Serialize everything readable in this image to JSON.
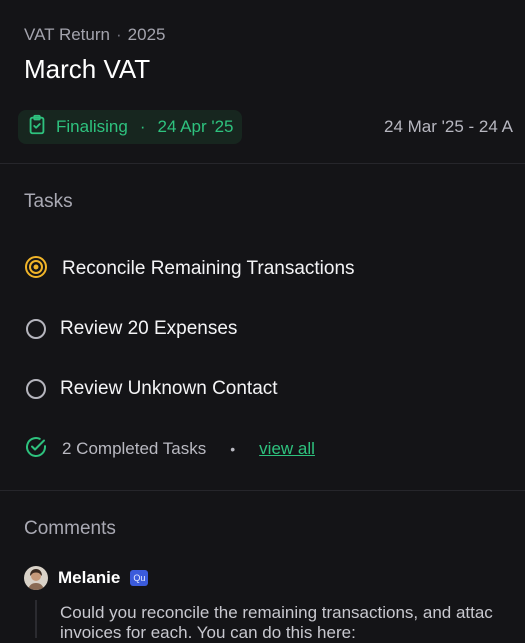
{
  "header": {
    "subtitle_prefix": "VAT Return",
    "subtitle_year": "2025",
    "title": "March VAT"
  },
  "status": {
    "label": "Finalising",
    "date": "24 Apr '25",
    "color": "#2ec27e"
  },
  "period": {
    "range": "24 Mar '25 - 24 A"
  },
  "tasks": {
    "heading": "Tasks",
    "items": [
      {
        "label": "Reconcile Remaining Transactions",
        "state": "in-progress",
        "icon": "target-icon"
      },
      {
        "label": "Review 20 Expenses",
        "state": "todo",
        "icon": "circle-icon"
      },
      {
        "label": "Review Unknown Contact",
        "state": "todo",
        "icon": "circle-icon"
      }
    ],
    "completed_label": "2 Completed Tasks",
    "view_all": "view all"
  },
  "comments": {
    "heading": "Comments",
    "items": [
      {
        "author": "Melanie",
        "badge": "Qu",
        "line1": "Could you reconcile the remaining transactions, and attac",
        "line2": "invoices for each. You can do this here:"
      }
    ]
  }
}
